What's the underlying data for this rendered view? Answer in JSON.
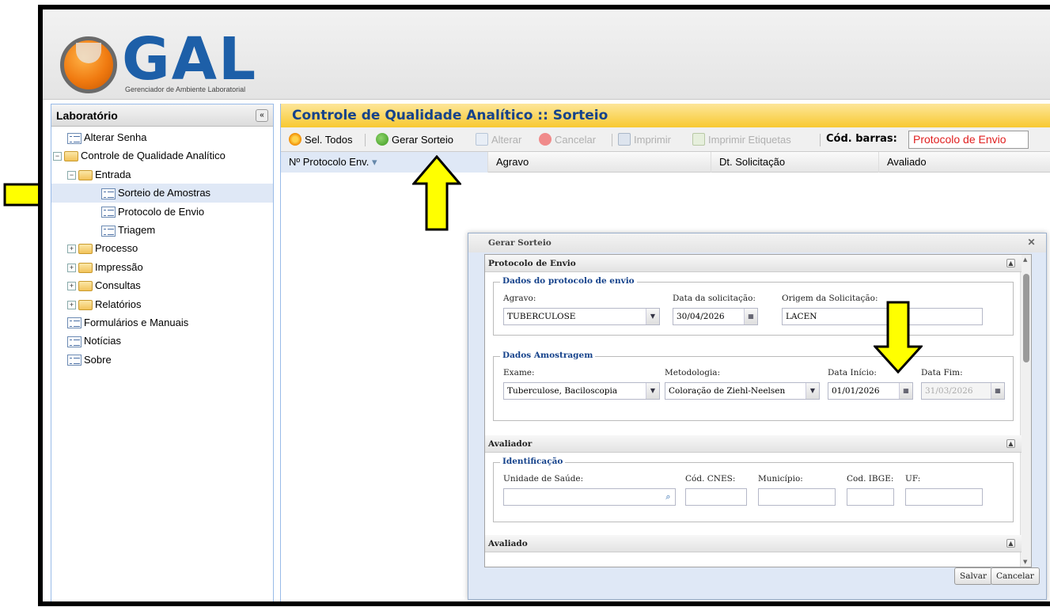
{
  "app": {
    "logo_text": "GAL",
    "logo_subtitle": "Gerenciador de Ambiente Laboratorial"
  },
  "sidebar": {
    "title": "Laboratório",
    "collapse_glyph": "«",
    "items": [
      {
        "label": "Alterar Senha",
        "icon": "page-icon"
      },
      {
        "label": "Controle de Qualidade Analítico",
        "icon": "folder-icon"
      },
      {
        "label": "Entrada",
        "icon": "folder-icon"
      },
      {
        "label": "Sorteio de Amostras",
        "icon": "page-icon"
      },
      {
        "label": "Protocolo de Envio",
        "icon": "page-icon"
      },
      {
        "label": "Triagem",
        "icon": "page-icon"
      },
      {
        "label": "Processo",
        "icon": "folder-icon"
      },
      {
        "label": "Impressão",
        "icon": "folder-icon"
      },
      {
        "label": "Consultas",
        "icon": "folder-icon"
      },
      {
        "label": "Relatórios",
        "icon": "folder-icon"
      },
      {
        "label": "Formulários e Manuais",
        "icon": "page-icon"
      },
      {
        "label": "Notícias",
        "icon": "page-icon"
      },
      {
        "label": "Sobre",
        "icon": "page-icon"
      }
    ]
  },
  "main": {
    "title": "Controle de Qualidade Analítico :: Sorteio",
    "toolbar": {
      "select_all": "Sel. Todos",
      "generate": "Gerar Sorteio",
      "edit": "Alterar",
      "cancel": "Cancelar",
      "print": "Imprimir",
      "print_labels": "Imprimir Etiquetas",
      "barcode_label": "Cód. barras:",
      "barcode_value": "Protocolo de Envio"
    },
    "grid_columns": [
      "Nº Protocolo Env.",
      "Agravo",
      "Dt. Solicitação",
      "Avaliado"
    ]
  },
  "dialog": {
    "title": "Gerar Sorteio",
    "section1": {
      "title": "Protocolo de Envio",
      "fieldset1": {
        "legend": "Dados do protocolo de envio",
        "agravo_label": "Agravo:",
        "agravo_value": "TUBERCULOSE",
        "data_label": "Data da solicitação:",
        "data_value": "30/04/2026",
        "origem_label": "Origem da Solicitação:",
        "origem_value": "LACEN"
      },
      "fieldset2": {
        "legend": "Dados Amostragem",
        "exame_label": "Exame:",
        "exame_value": "Tuberculose, Baciloscopia",
        "metodologia_label": "Metodologia:",
        "metodologia_value": "Coloração de Ziehl-Neelsen",
        "inicio_label": "Data Início:",
        "inicio_value": "01/01/2026",
        "fim_label": "Data Fim:",
        "fim_value": "31/03/2026"
      }
    },
    "section2": {
      "title": "Avaliador",
      "legend": "Identificação",
      "unidade_label": "Unidade de Saúde:",
      "cnes_label": "Cód. CNES:",
      "municipio_label": "Município:",
      "ibge_label": "Cod. IBGE:",
      "uf_label": "UF:"
    },
    "section3": {
      "title": "Avaliado"
    },
    "save": "Salvar",
    "cancel": "Cancelar"
  },
  "colors": {
    "accent_blue": "#15428b",
    "title_bar_yellow": "#f8c931",
    "arrow_yellow": "#ffff00",
    "barcode_red": "#e02020"
  }
}
